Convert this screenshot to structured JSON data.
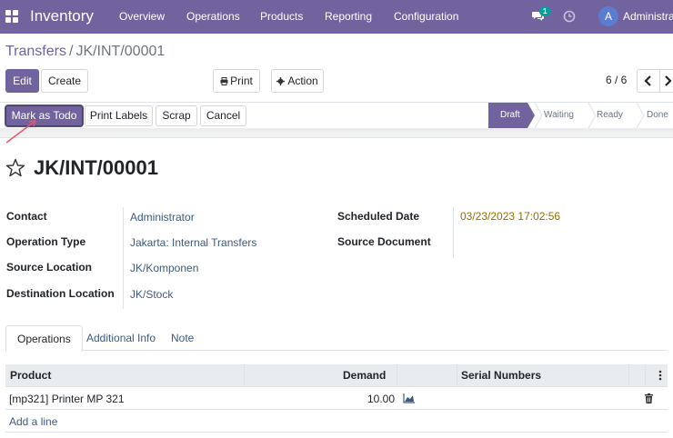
{
  "app": {
    "name": "Inventory",
    "menu": [
      "Overview",
      "Operations",
      "Products",
      "Reporting",
      "Configuration"
    ],
    "chat_badge": "1",
    "user_initial": "A",
    "user_name": "Administrator",
    "brand_color": "#71639e"
  },
  "breadcrumb": {
    "parent": "Transfers",
    "separator": "/",
    "current": "JK/INT/00001"
  },
  "toolbar": {
    "edit_label": "Edit",
    "create_label": "Create",
    "print_label": "Print",
    "action_label": "Action",
    "print_icon": "printer-icon",
    "action_icon": "gear-icon"
  },
  "pager": {
    "value": "6 / 6",
    "prev_icon": "chevron-left-icon",
    "next_icon": "chevron-right-icon"
  },
  "statusbar": {
    "buttons": [
      "Mark as Todo",
      "Print Labels",
      "Scrap",
      "Cancel"
    ],
    "stages": [
      "Draft",
      "Waiting",
      "Ready",
      "Done"
    ],
    "active_stage": "Draft"
  },
  "record": {
    "title": "JK/INT/00001",
    "favorite_icon": "star-outline-icon"
  },
  "fields": {
    "contact_label": "Contact",
    "contact_value": "Administrator",
    "operation_type_label": "Operation Type",
    "operation_type_value": "Jakarta: Internal Transfers",
    "source_location_label": "Source Location",
    "source_location_value": "JK/Komponen",
    "destination_location_label": "Destination Location",
    "destination_location_value": "JK/Stock",
    "scheduled_date_label": "Scheduled Date",
    "scheduled_date_value": "03/23/2023 17:02:56",
    "source_document_label": "Source Document",
    "source_document_value": ""
  },
  "tabs": [
    "Operations",
    "Additional Info",
    "Note"
  ],
  "active_tab": "Operations",
  "operations_table": {
    "columns": [
      "Product",
      "Demand",
      "",
      "Serial Numbers"
    ],
    "rows": [
      {
        "product": "[mp321] Printer MP 321",
        "demand": "10.00",
        "forecast_icon": "area-chart-icon",
        "serial_numbers": "",
        "delete_icon": "trash-icon"
      }
    ],
    "add_line_label": "Add a line",
    "options_icon": "vertical-ellipsis-icon"
  }
}
